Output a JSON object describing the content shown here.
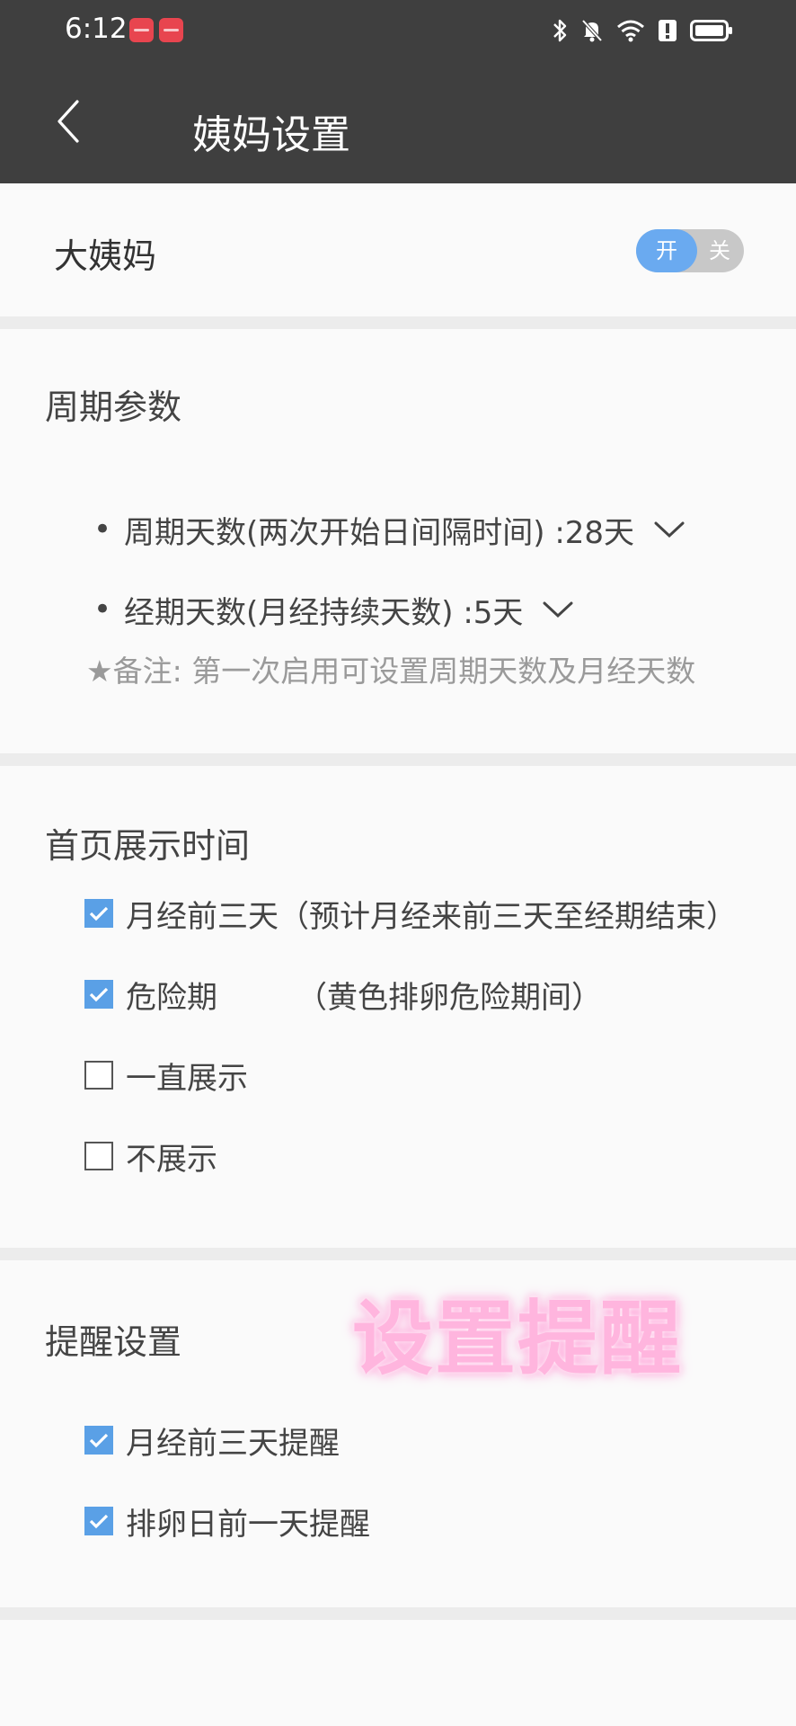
{
  "status_bar": {
    "time": "6:12",
    "icons": [
      "app-badge-icon",
      "app-badge-icon",
      "bluetooth-icon",
      "bell-off-icon",
      "wifi-icon",
      "alert-icon",
      "battery-icon"
    ]
  },
  "header": {
    "title": "姨妈设置",
    "back_icon": "back-arrow-icon"
  },
  "period_toggle": {
    "label": "大姨妈",
    "on_label": "开",
    "off_label": "关",
    "state": "on"
  },
  "cycle_params": {
    "title": "周期参数",
    "bullet": "•",
    "items": [
      {
        "label": "周期天数(两次开始日间隔时间) :28天"
      },
      {
        "label": "经期天数(月经持续天数) :5天"
      }
    ],
    "note": "★备注: 第一次启用可设置周期天数及月经天数"
  },
  "display_time": {
    "title": "首页展示时间",
    "options": [
      {
        "label": "月经前三天（预计月经来前三天至经期结束）",
        "checked": true
      },
      {
        "label": "危险期",
        "extra": "（黄色排卵危险期间）",
        "checked": true
      },
      {
        "label": "一直展示",
        "checked": false
      },
      {
        "label": "不展示",
        "checked": false
      }
    ]
  },
  "reminder": {
    "title": "提醒设置",
    "options": [
      {
        "label": "月经前三天提醒",
        "checked": true
      },
      {
        "label": "排卵日前一天提醒",
        "checked": true
      }
    ],
    "overlay_text": "设置提醒"
  },
  "colors": {
    "header_bg": "#3f3f3f",
    "accent": "#5aa0e6",
    "toggle_on": "#6aaaf0",
    "overlay_pink": "#ffb5de"
  }
}
